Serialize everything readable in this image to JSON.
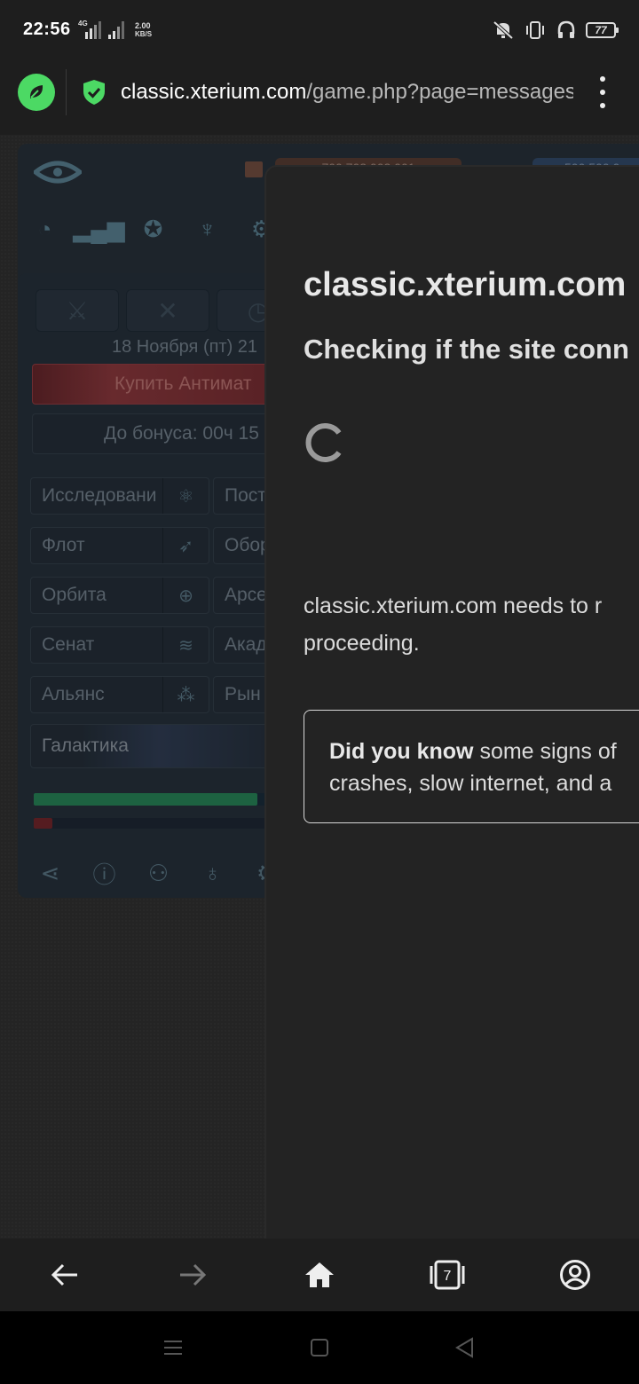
{
  "status_bar": {
    "time": "22:56",
    "network_type": "4G",
    "speed_value": "2.00",
    "speed_unit": "KB/S",
    "battery": "77"
  },
  "browser": {
    "url_host": "classic.xterium.com",
    "url_path": "/game.php?page=messages",
    "security": "shield-check-icon",
    "accent_color": "#4cd964"
  },
  "game": {
    "resource_1": "700.702.002.001",
    "resource_2": "500.500.0",
    "date_text": "18 Ноября (пт) 21",
    "buy_label": "Купить Антимат",
    "bonus_label": "До бонуса: 00ч 15",
    "menu": [
      {
        "left": "Исследовани",
        "left_icon": "atom-icon",
        "right": "Пост"
      },
      {
        "left": "Флот",
        "left_icon": "rocket-icon",
        "right": "Обор"
      },
      {
        "left": "Орбита",
        "left_icon": "target-icon",
        "right": "Арсе"
      },
      {
        "left": "Сенат",
        "left_icon": "layers-icon",
        "right": "Акад"
      },
      {
        "left": "Альянс",
        "left_icon": "group-icon",
        "right": "Рын"
      }
    ],
    "galaxy_label": "Галактика",
    "progress_green": 0.96,
    "progress_red": 0.08
  },
  "modal": {
    "title": "classic.xterium.com",
    "subtitle": "Checking if the site conn",
    "body_line1": "classic.xterium.com needs to r",
    "body_line2": "proceeding.",
    "dyk_bold": "Did you know",
    "dyk_line1_rest": " some signs of",
    "dyk_line2": "crashes, slow internet, and a"
  },
  "nav": {
    "tabs_count": "7"
  }
}
